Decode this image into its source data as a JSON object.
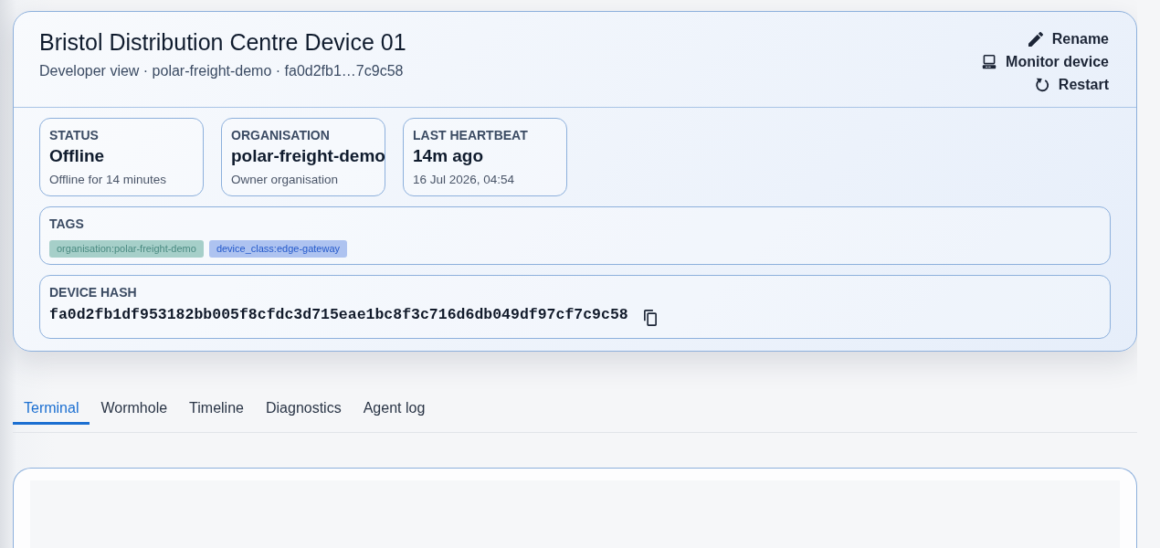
{
  "device": {
    "title": "Bristol Distribution Centre Device 01",
    "subtitle": "Developer view · polar-freight-demo · fa0d2fb1…7c9c58",
    "actions": [
      {
        "kind": "rename",
        "label": "Rename"
      },
      {
        "kind": "monitor",
        "label": "Monitor device"
      },
      {
        "kind": "restart",
        "label": "Restart"
      }
    ]
  },
  "stats": [
    {
      "label": "STATUS",
      "value": "Offline",
      "detail": "Offline for 14 minutes"
    },
    {
      "label": "ORGANISATION",
      "value": "polar-freight-demo",
      "detail": "Owner organisation"
    },
    {
      "label": "LAST HEARTBEAT",
      "value": "14m ago",
      "detail": "16 Jul 2026, 04:54"
    }
  ],
  "tags": {
    "label": "TAGS",
    "items": [
      {
        "text": "organisation:polar-freight-demo",
        "color": "#a6cfc9"
      },
      {
        "text": "device_class:edge-gateway",
        "color": "#aec3f0"
      }
    ]
  },
  "device_hash": {
    "label": "DEVICE HASH",
    "value": "fa0d2fb1df953182bb005f8cfdc3d715eae1bc8f3c716d6db049df97cf7c9c58"
  },
  "tabs": [
    {
      "label": "Terminal",
      "selected": true
    },
    {
      "label": "Wormhole",
      "selected": false
    },
    {
      "label": "Timeline",
      "selected": false
    },
    {
      "label": "Diagnostics",
      "selected": false
    },
    {
      "label": "Agent log",
      "selected": false
    }
  ]
}
